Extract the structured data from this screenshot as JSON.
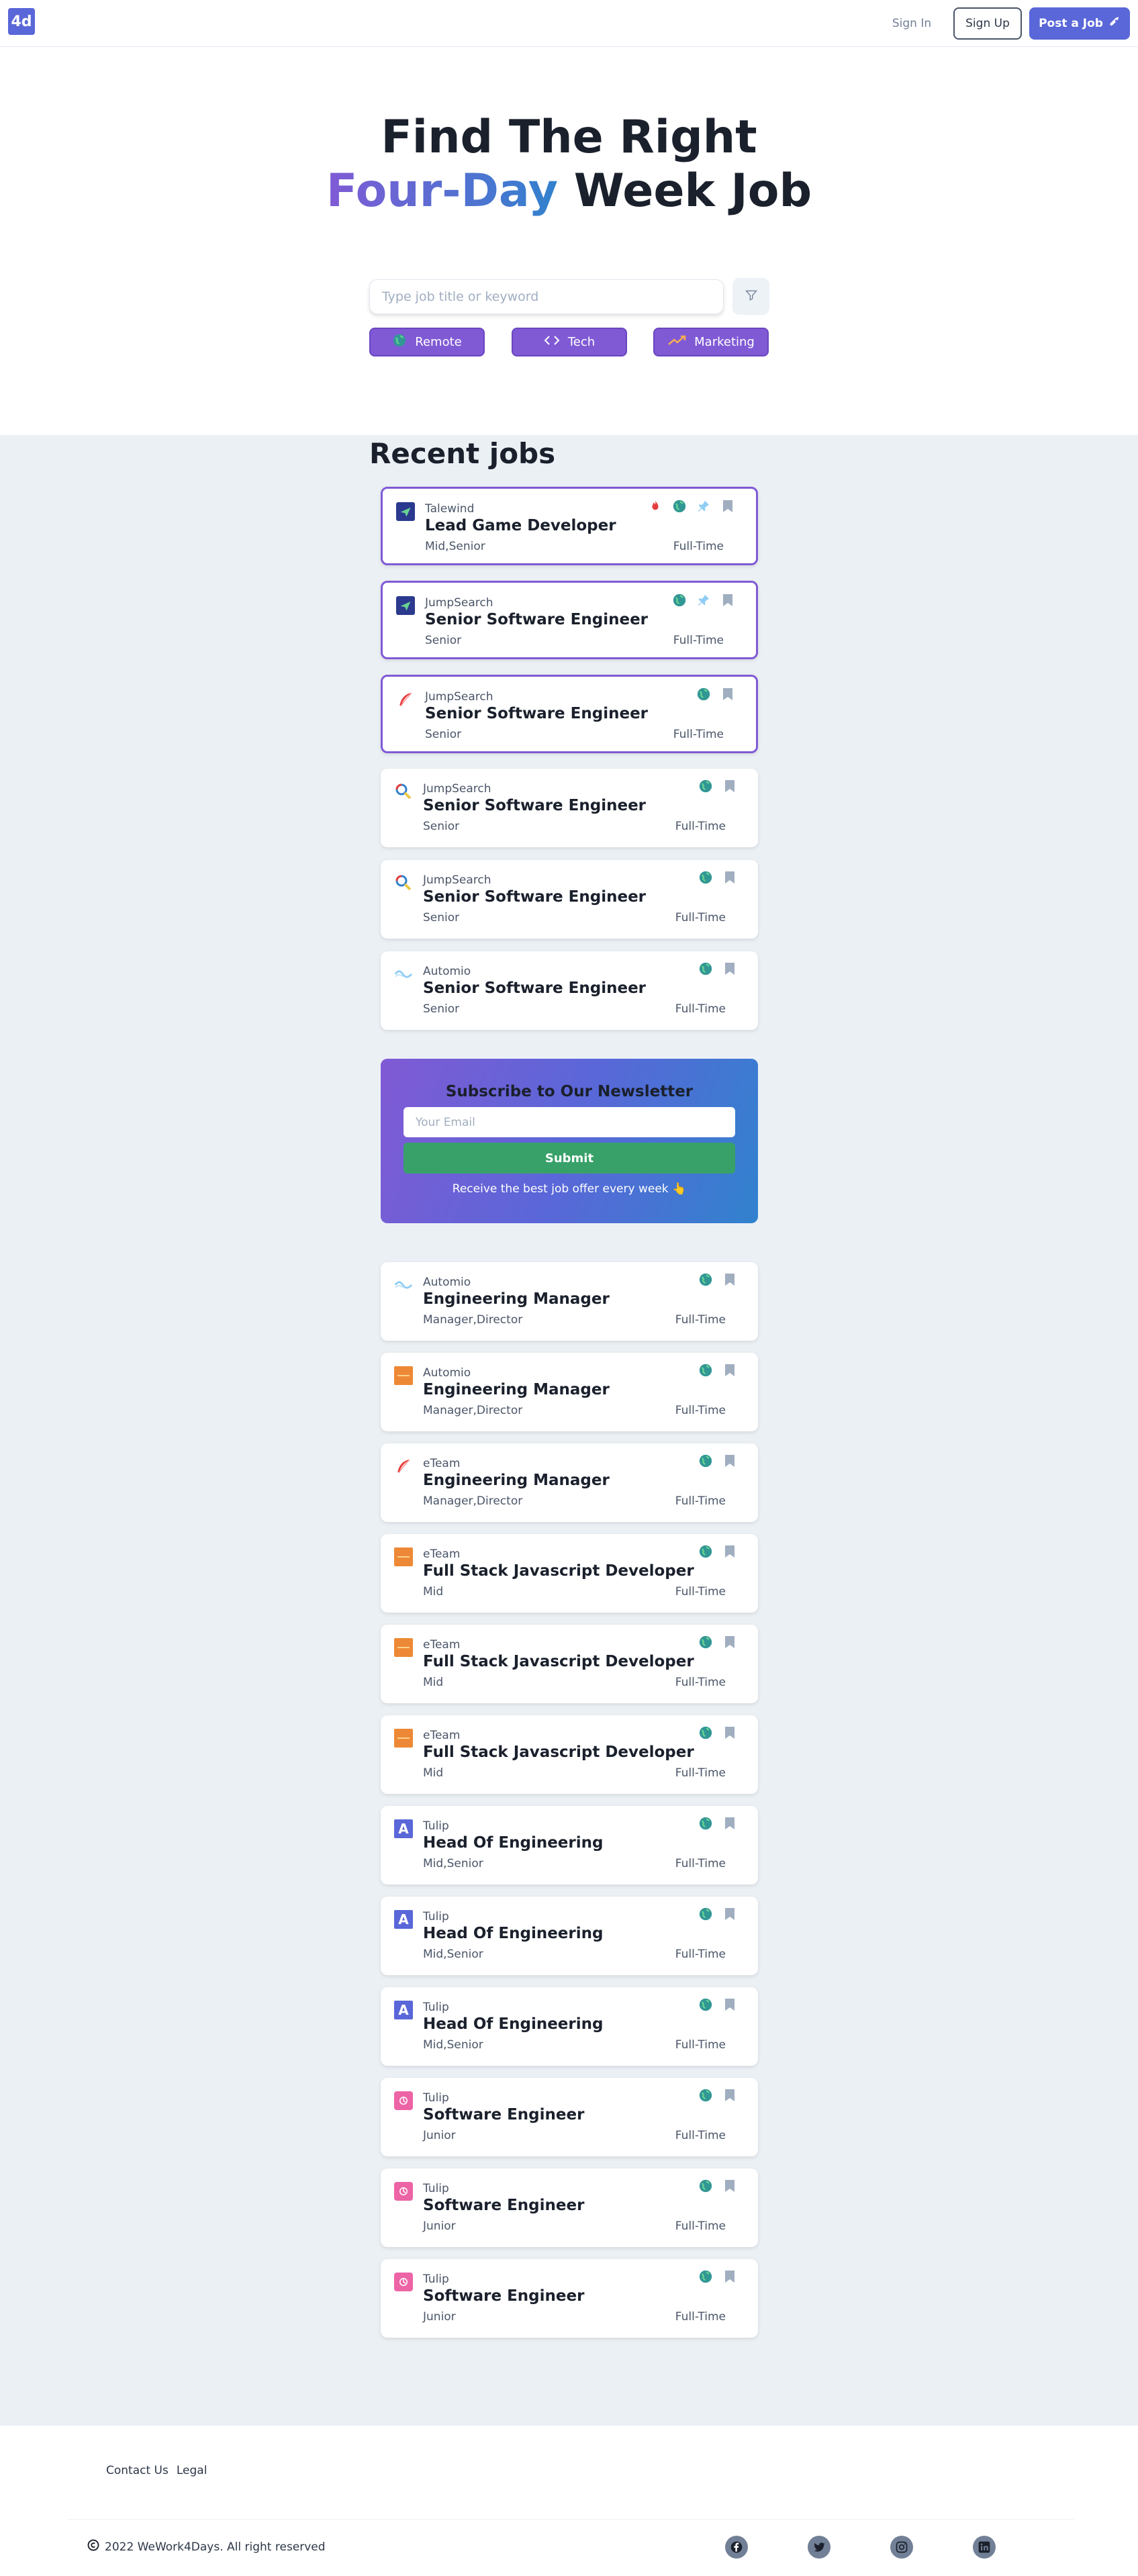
{
  "header": {
    "logo": "4d",
    "signin": "Sign In",
    "signup": "Sign Up",
    "post_job": "Post a Job"
  },
  "hero": {
    "line1": "Find The Right",
    "accent": "Four-Day",
    "line2_rest": " Week Job",
    "search_placeholder": "Type job title or keyword"
  },
  "tags": [
    {
      "label": "Remote",
      "icon": "globe-icon"
    },
    {
      "label": "Tech",
      "icon": "code-icon"
    },
    {
      "label": "Marketing",
      "icon": "trending-up-icon"
    }
  ],
  "recent_title": "Recent jobs",
  "jobs_top": [
    {
      "company": "Talewind",
      "title": "Lead Game Developer",
      "level": "Mid,Senior",
      "type": "Full-Time",
      "featured": true,
      "hot": true,
      "pinned": true,
      "logo": "plane-logo"
    },
    {
      "company": "JumpSearch",
      "title": "Senior Software Engineer",
      "level": "Senior",
      "type": "Full-Time",
      "featured": true,
      "hot": false,
      "pinned": true,
      "logo": "plane-logo"
    },
    {
      "company": "JumpSearch",
      "title": "Senior Software Engineer",
      "level": "Senior",
      "type": "Full-Time",
      "featured": true,
      "hot": false,
      "pinned": false,
      "logo": "feather-logo"
    },
    {
      "company": "JumpSearch",
      "title": "Senior Software Engineer",
      "level": "Senior",
      "type": "Full-Time",
      "featured": false,
      "hot": false,
      "pinned": false,
      "logo": "magnifier-logo"
    },
    {
      "company": "JumpSearch",
      "title": "Senior Software Engineer",
      "level": "Senior",
      "type": "Full-Time",
      "featured": false,
      "hot": false,
      "pinned": false,
      "logo": "magnifier-logo"
    },
    {
      "company": "Automio",
      "title": "Senior Software Engineer",
      "level": "Senior",
      "type": "Full-Time",
      "featured": false,
      "hot": false,
      "pinned": false,
      "logo": "wave-logo"
    }
  ],
  "newsletter": {
    "title": "Subscribe to Our Newsletter",
    "placeholder": "Your Email",
    "submit": "Submit",
    "note": "Receive the best job offer every week 👆"
  },
  "jobs_bottom": [
    {
      "company": "Automio",
      "title": "Engineering Manager",
      "level": "Manager,Director",
      "type": "Full-Time",
      "logo": "wave-logo"
    },
    {
      "company": "Automio",
      "title": "Engineering Manager",
      "level": "Manager,Director",
      "type": "Full-Time",
      "logo": "orange-logo"
    },
    {
      "company": "eTeam",
      "title": "Engineering Manager",
      "level": "Manager,Director",
      "type": "Full-Time",
      "logo": "feather-logo"
    },
    {
      "company": "eTeam",
      "title": "Full Stack Javascript Developer",
      "level": "Mid",
      "type": "Full-Time",
      "logo": "orange-logo"
    },
    {
      "company": "eTeam",
      "title": "Full Stack Javascript Developer",
      "level": "Mid",
      "type": "Full-Time",
      "logo": "orange-logo"
    },
    {
      "company": "eTeam",
      "title": "Full Stack Javascript Developer",
      "level": "Mid",
      "type": "Full-Time",
      "logo": "orange-logo"
    },
    {
      "company": "Tulip",
      "title": "Head Of Engineering",
      "level": "Mid,Senior",
      "type": "Full-Time",
      "logo": "a-logo"
    },
    {
      "company": "Tulip",
      "title": "Head Of Engineering",
      "level": "Mid,Senior",
      "type": "Full-Time",
      "logo": "a-logo"
    },
    {
      "company": "Tulip",
      "title": "Head Of Engineering",
      "level": "Mid,Senior",
      "type": "Full-Time",
      "logo": "a-logo"
    },
    {
      "company": "Tulip",
      "title": "Software Engineer",
      "level": "Junior",
      "type": "Full-Time",
      "logo": "pink-logo"
    },
    {
      "company": "Tulip",
      "title": "Software Engineer",
      "level": "Junior",
      "type": "Full-Time",
      "logo": "pink-logo"
    },
    {
      "company": "Tulip",
      "title": "Software Engineer",
      "level": "Junior",
      "type": "Full-Time",
      "logo": "pink-logo"
    }
  ],
  "footer": {
    "links": [
      "Contact Us",
      "Legal"
    ],
    "copyright": "2022 WeWork4Days. All right reserved",
    "social": [
      "facebook-icon",
      "twitter-icon",
      "instagram-icon",
      "linkedin-icon"
    ]
  },
  "colors": {
    "brand": "#5a67d8",
    "tag": "#805ad5",
    "submit": "#38a169",
    "page_bg": "#ebf0f5"
  }
}
